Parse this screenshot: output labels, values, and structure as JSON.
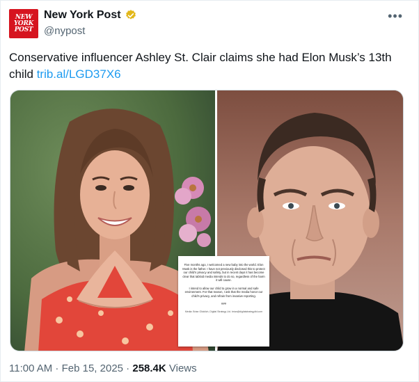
{
  "author": {
    "name": "New York Post",
    "handle": "@nypost",
    "logo_lines": [
      "NEW",
      "YORK",
      "POST"
    ],
    "logo_color": "#d6141f",
    "verified_badge_color": "#e2b719"
  },
  "menu": {
    "more_label": "•••"
  },
  "tweet": {
    "text": "Conservative influencer Ashley St. Clair claims she had Elon Musk’s 13th child ",
    "link": "trib.al/LGD37X6",
    "link_color": "#1d9bf0"
  },
  "media": {
    "statement_paragraphs": [
      "Five months ago, I welcomed a new baby into the world. Elon Musk is the father. I have not previously disclosed this to protect our child’s privacy and safety, but in recent days it has become clear that tabloid media intends to do so, regardless of the harm it will cause.",
      "I intend to allow our child to grow in a normal and safe environment. For that reason, I ask that the media honor our child’s privacy, and refrain from invasive reporting.",
      "###"
    ],
    "statement_signature": "Media: Brian Glicklich, Digital Strategy Ltd. brian@digitalstrategyltd.com"
  },
  "meta": {
    "time": "11:00 AM",
    "separator": " · ",
    "date": "Feb 15, 2025",
    "views_count": "258.4K",
    "views_label": " Views"
  }
}
